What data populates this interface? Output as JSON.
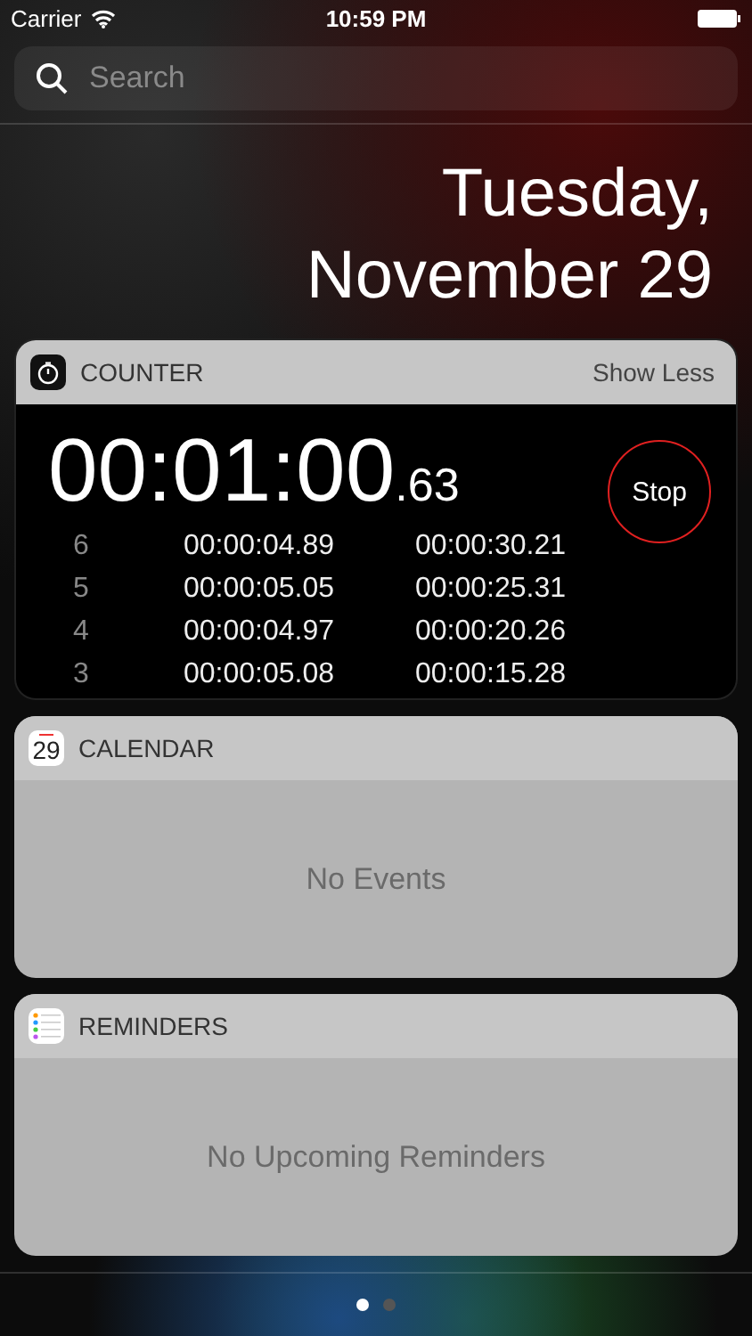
{
  "status_bar": {
    "carrier": "Carrier",
    "time": "10:59 PM"
  },
  "search": {
    "placeholder": "Search"
  },
  "date": {
    "line_1": "Tuesday,",
    "line_2": "November 29"
  },
  "widgets": [
    {
      "kind": "stopwatch",
      "title": "COUNTER",
      "action": "Show Less",
      "elapsed": "00:01:00",
      "fraction": ".63",
      "button": "Stop",
      "laps": [
        {
          "number": "6",
          "lap": "00:00:04.89",
          "total": "00:00:30.21"
        },
        {
          "number": "5",
          "lap": "00:00:05.05",
          "total": "00:00:25.31"
        },
        {
          "number": "4",
          "lap": "00:00:04.97",
          "total": "00:00:20.26"
        },
        {
          "number": "3",
          "lap": "00:00:05.08",
          "total": "00:00:15.28"
        }
      ]
    },
    {
      "kind": "calendar",
      "icon_text": "29",
      "title": "CALENDAR",
      "message": "No Events"
    },
    {
      "kind": "reminders",
      "title": "REMINDERS",
      "message": "No Upcoming Reminders"
    }
  ],
  "page_dots": [
    {
      "selected": true
    },
    {
      "selected": false
    }
  ]
}
